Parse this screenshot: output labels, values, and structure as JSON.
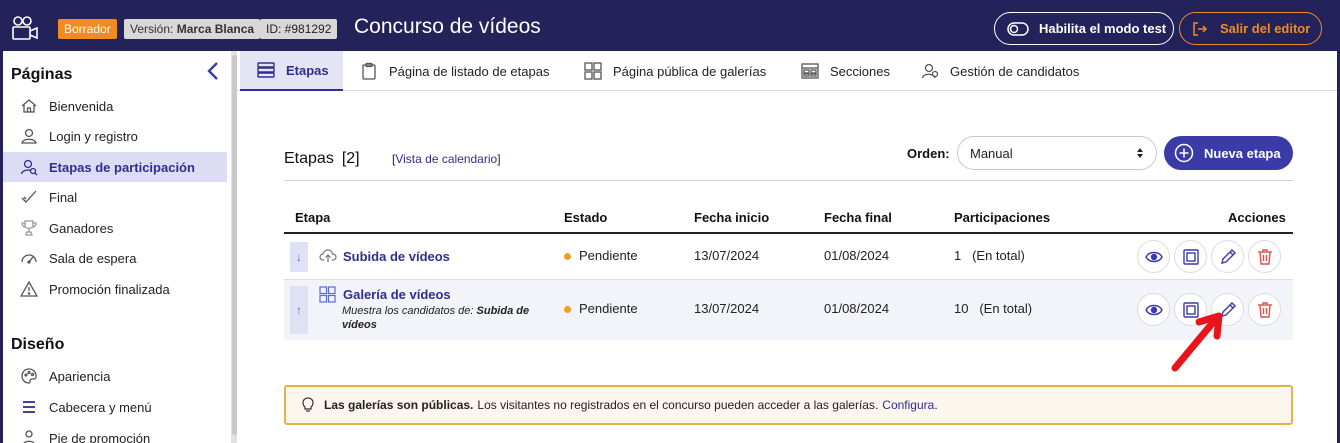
{
  "topbar": {
    "badge_draft": "Borrador",
    "badge_version_prefix": "Versión:",
    "badge_version_value": "Marca Blanca",
    "badge_id": "ID: #981292",
    "title": "Concurso de vídeos",
    "test_mode_label": "Habilita el modo test",
    "exit_label": "Salir del editor"
  },
  "sidebar": {
    "pages_heading": "Páginas",
    "design_heading": "Diseño",
    "pages": [
      {
        "label": "Bienvenida",
        "icon": "home-icon"
      },
      {
        "label": "Login y registro",
        "icon": "user-icon"
      },
      {
        "label": "Etapas de participación",
        "icon": "user-search-icon",
        "active": true
      },
      {
        "label": "Final",
        "icon": "check-icon"
      },
      {
        "label": "Ganadores",
        "icon": "trophy-icon"
      },
      {
        "label": "Sala de espera",
        "icon": "gauge-icon"
      },
      {
        "label": "Promoción finalizada",
        "icon": "warning-icon"
      }
    ],
    "design": [
      {
        "label": "Apariencia",
        "icon": "palette-icon"
      },
      {
        "label": "Cabecera y menú",
        "icon": "menu-icon"
      },
      {
        "label": "Pie de promoción",
        "icon": "footer-icon"
      }
    ]
  },
  "tabs": [
    {
      "label": "Etapas",
      "icon": "stages-icon",
      "active": true
    },
    {
      "label": "Página de listado de etapas",
      "icon": "clipboard-icon"
    },
    {
      "label": "Página pública de galerías",
      "icon": "grid-icon"
    },
    {
      "label": "Secciones",
      "icon": "sections-icon"
    },
    {
      "label": "Gestión de candidatos",
      "icon": "candidates-icon"
    }
  ],
  "stages": {
    "title": "Etapas",
    "count": "[2]",
    "calendar_link": "Vista de calendario",
    "order_label": "Orden:",
    "order_value": "Manual",
    "new_button": "Nueva etapa",
    "columns": [
      "Etapa",
      "Estado",
      "Fecha inicio",
      "Fecha final",
      "Participaciones",
      "Acciones"
    ],
    "rows": [
      {
        "arrow": "↓",
        "name": "Subida de vídeos",
        "icon": "cloud-upload-icon",
        "status": "Pendiente",
        "start": "13/07/2024",
        "end": "01/08/2024",
        "participations": "1",
        "participations_note": "(En total)"
      },
      {
        "arrow": "↑",
        "name": "Galería de vídeos",
        "icon": "gallery-icon",
        "note_prefix": "Muestra los candidatos de:",
        "note_value": "Subida de vídeos",
        "status": "Pendiente",
        "start": "13/07/2024",
        "end": "01/08/2024",
        "participations": "10",
        "participations_note": "(En total)"
      }
    ]
  },
  "notice": {
    "bold": "Las galerías son públicas.",
    "text": "Los visitantes no registrados en el concurso pueden acceder a las galerías.",
    "link": "Configura",
    "end": "."
  },
  "colors": {
    "navy": "#23225a",
    "accent": "#3b3ba8",
    "orange": "#f08c1f",
    "danger": "#d9534f"
  }
}
